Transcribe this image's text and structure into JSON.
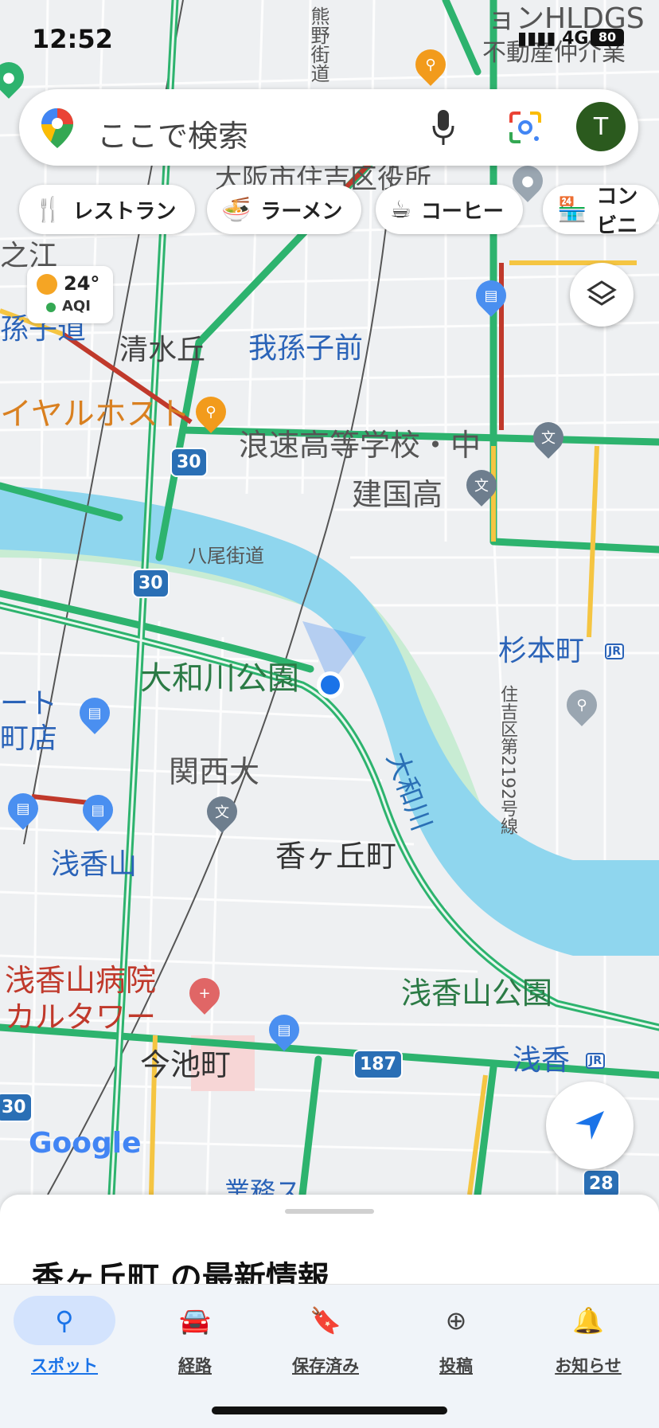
{
  "status_bar": {
    "time": "12:52",
    "network": "4G",
    "battery": "80"
  },
  "search": {
    "placeholder": "ここで検索",
    "avatar_letter": "T"
  },
  "chips": [
    {
      "label": "レストラン",
      "icon": "restaurant-icon"
    },
    {
      "label": "ラーメン",
      "icon": "ramen-icon"
    },
    {
      "label": "コーヒー",
      "icon": "coffee-icon"
    },
    {
      "label": "コンビニ",
      "icon": "convenience-store-icon"
    }
  ],
  "weather": {
    "temp": "24°",
    "aqi": "AQI"
  },
  "map_labels": {
    "top_building": "ョンHLDGS",
    "top_sub": "不動産仲介業",
    "kumano": "熊野街道",
    "sumiyoshi_office": "大阪市住吉区役所",
    "nokoe": "之江",
    "station_left": "孫子道",
    "shimizugaoka": "清水丘",
    "abikomae": "我孫子前",
    "royal_host": "イヤルホスト",
    "naniwa_school": "浪速高等学校・中",
    "kenkoku": "建国高",
    "yao_kaido": "八尾街道",
    "yamato_park": "大和川公園",
    "yamato_river": "大和川",
    "sugimoto": "杉本町",
    "route_2192": "住吉区第2192号線",
    "left_store_a": "ート",
    "left_store_b": "町店",
    "kansai": "関西大",
    "asakayama_st": "浅香山",
    "kokagaoka": "香ヶ丘町",
    "hospital_a": "浅香山病院",
    "hospital_b": "カルタワー",
    "asakayama_park": "浅香山公園",
    "imaike": "今池町",
    "asaka": "浅香",
    "bottom_road": "業務ス",
    "google": "Google",
    "jr": "JR"
  },
  "route_shields": [
    "30",
    "30",
    "187",
    "30",
    "28"
  ],
  "sheet": {
    "title": "香ヶ丘町 の最新情報"
  },
  "nav": [
    {
      "label": "スポット",
      "icon": "explore-pin-icon",
      "active": true
    },
    {
      "label": "経路",
      "icon": "commute-car-icon",
      "active": false
    },
    {
      "label": "保存済み",
      "icon": "bookmark-icon",
      "active": false
    },
    {
      "label": "投稿",
      "icon": "add-circle-icon",
      "active": false
    },
    {
      "label": "お知らせ",
      "icon": "bell-icon",
      "active": false
    }
  ],
  "colors": {
    "river": "#8fd6ee",
    "park": "#c8ecd3",
    "highway": "#2db36e",
    "traffic_red": "#c0392b",
    "traffic_yellow": "#f5c542",
    "accent_blue": "#1a73e8",
    "nav_bg": "#f0f4f9",
    "nav_active": "#d3e3fd"
  }
}
